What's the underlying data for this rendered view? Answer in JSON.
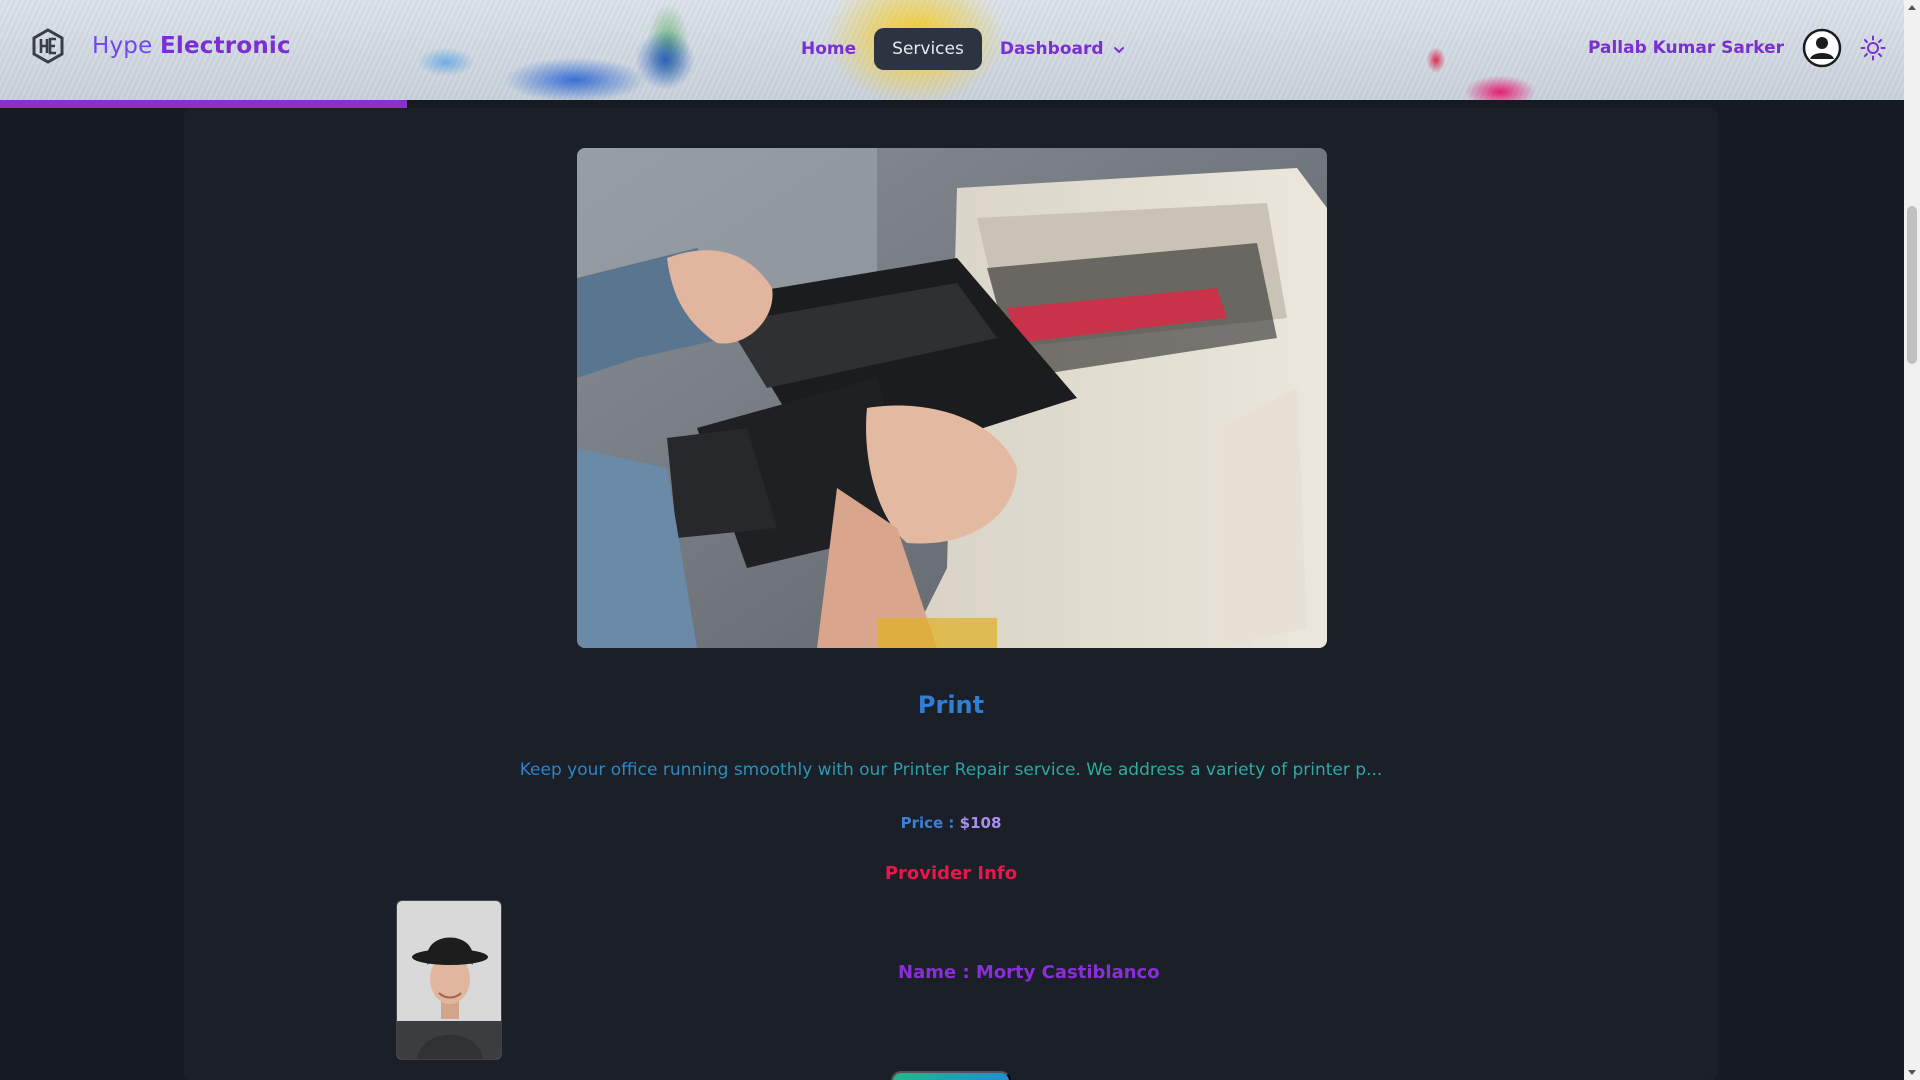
{
  "navbar": {
    "brand": {
      "word1": "Hype",
      "word2": "Electronic",
      "logo_icon": "hexagon-he-logo-icon"
    },
    "links": [
      {
        "label": "Home",
        "active": false
      },
      {
        "label": "Services",
        "active": true
      },
      {
        "label": "Dashboard",
        "active": false,
        "has_dropdown": true
      }
    ],
    "user": {
      "name": "Pallab Kumar Sarker",
      "avatar_icon": "user-circle-icon",
      "theme_icon": "sun-icon"
    },
    "accent_color": "#7b2fd0"
  },
  "service": {
    "title": "Print",
    "image_subject": "hands-replacing-printer-toner-cartridge",
    "description": "Keep your office running smoothly with our Printer Repair service. We address a variety of printer p...",
    "price_label": "Price :",
    "price_value": "$108",
    "provider_heading": "Provider Info",
    "provider_name": "Name : Morty Castiblanco"
  },
  "colors": {
    "page_bg": "#161b22",
    "card_bg": "#1a1f28",
    "title": "#2f7fd6",
    "provider_heading": "#e8174a",
    "provider_name": "#8a2fd8"
  }
}
